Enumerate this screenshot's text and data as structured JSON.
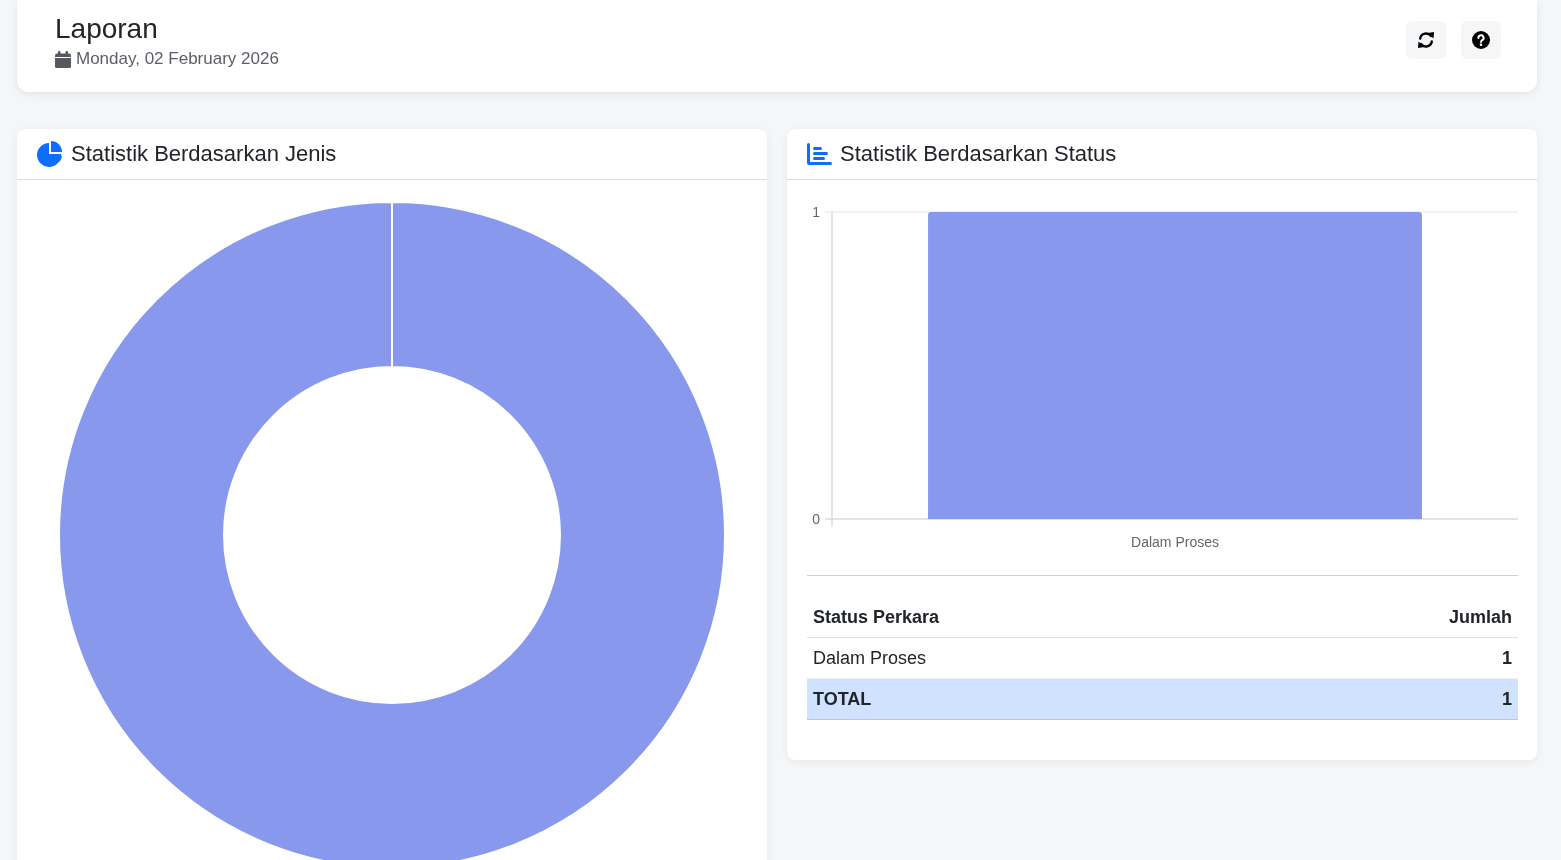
{
  "header": {
    "title": "Laporan",
    "date": "Monday, 02 February 2026"
  },
  "type_panel": {
    "title": "Statistik Berdasarkan Jenis"
  },
  "status_panel": {
    "title": "Statistik Berdasarkan Status",
    "chart_data": {
      "type": "bar",
      "categories": [
        "Dalam Proses"
      ],
      "series": [
        {
          "color": "#8898ec",
          "values": [
            1
          ]
        }
      ],
      "ylim": [
        0,
        1
      ],
      "yticks": [
        0,
        1
      ]
    },
    "table": {
      "columns": [
        "Status Perkara",
        "Jumlah"
      ],
      "rows": [
        {
          "kind": "data",
          "cells": [
            "Dalam Proses",
            "1"
          ]
        },
        {
          "kind": "total",
          "cells": [
            "TOTAL",
            "1"
          ]
        }
      ]
    }
  }
}
